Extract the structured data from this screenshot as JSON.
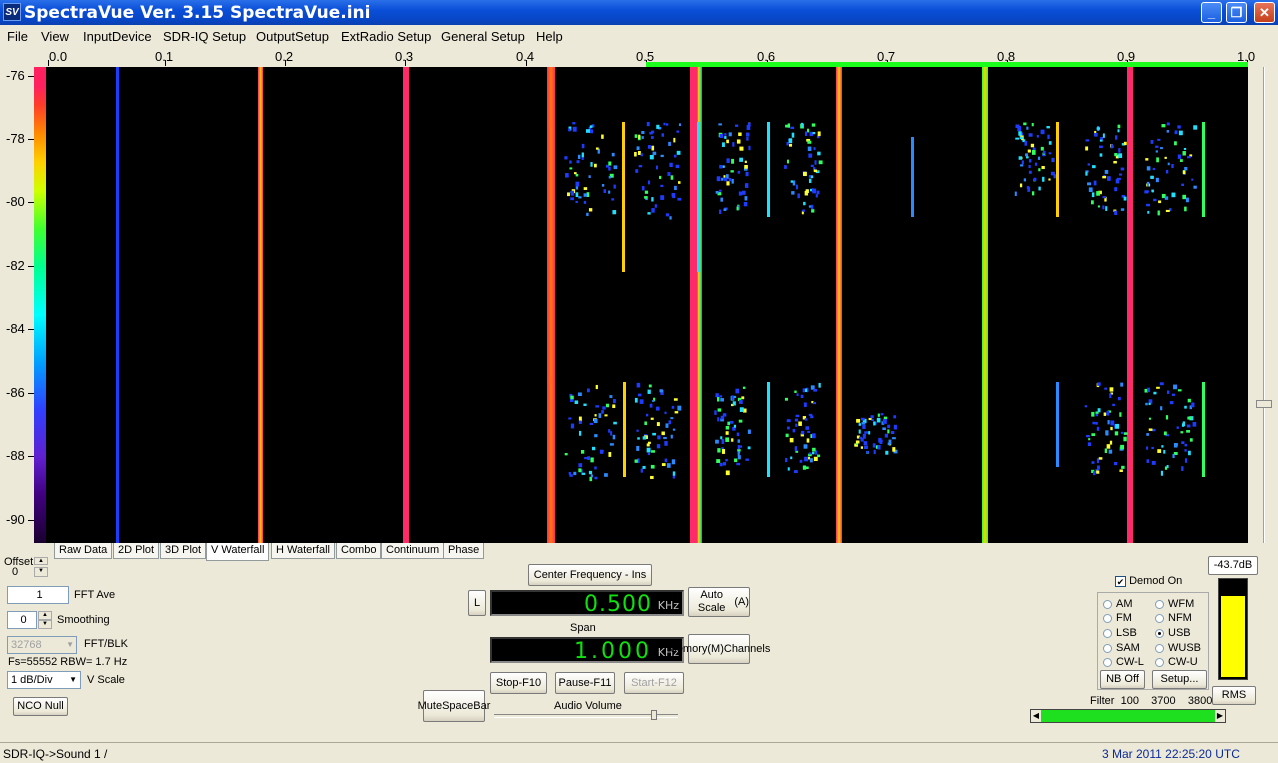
{
  "window": {
    "title": "SpectraVue Ver. 3.15  SpectraVue.ini",
    "icon": "SV"
  },
  "menu": [
    "File",
    "View",
    "InputDevice",
    "SDR-IQ Setup",
    "OutputSetup",
    "ExtRadio Setup",
    "General Setup",
    "Help"
  ],
  "plot": {
    "x_ticks": [
      "0.0",
      "0.1",
      "0.2",
      "0.3",
      "0.4",
      "0.5",
      "0.6",
      "0.7",
      "0.8",
      "0.9",
      "1.0"
    ],
    "y_ticks": [
      "-76",
      "-78",
      "-80",
      "-82",
      "-84",
      "-86",
      "-88",
      "-90"
    ]
  },
  "tabs": [
    "Raw Data",
    "2D Plot",
    "3D Plot",
    "V Waterfall",
    "H Waterfall",
    "Combo",
    "Continuum",
    "Phase"
  ],
  "active_tab": "V Waterfall",
  "left_panel": {
    "offset_label": "Offset",
    "offset_value": "0",
    "fft_ave_value": "1",
    "fft_ave_label": "FFT Ave",
    "smoothing_value": "0",
    "smoothing_label": "Smoothing",
    "fft_blk_value": "32768",
    "fft_blk_label": "FFT/BLK",
    "fs_info": "Fs=55552 RBW= 1.7 Hz",
    "vscale_value": "1 dB/Div",
    "vscale_label": "V Scale",
    "nco_null": "NCO Null"
  },
  "center": {
    "center_freq_button": "Center Frequency - Ins",
    "l_button": "L",
    "center_value": "0.500",
    "center_unit": "KHz",
    "span_label": "Span",
    "span_value": "1.000",
    "span_unit": "KHz",
    "auto_scale": [
      "Auto Scale",
      "(A)"
    ],
    "memory": [
      "Memory(M)",
      "Channels"
    ],
    "stop": "Stop-F10",
    "pause": "Pause-F11",
    "start": "Start-F12",
    "mute": [
      "Mute",
      "SpaceBar"
    ],
    "audio_volume_label": "Audio Volume",
    "audio_volume_level": 0.88
  },
  "demod": {
    "level_label": "-43.7dB",
    "demod_on_label": "Demod On",
    "demod_on_checked": true,
    "modes": [
      "AM",
      "WFM",
      "FM",
      "NFM",
      "LSB",
      "USB",
      "SAM",
      "WUSB",
      "CW-L",
      "CW-U"
    ],
    "selected": "USB",
    "nb_off": "NB Off",
    "setup": "Setup...",
    "rms": "RMS",
    "meter_level": 0.83,
    "filter_label": "Filter",
    "filter_values": [
      "100",
      "3700",
      "3800"
    ]
  },
  "status": {
    "left": "SDR-IQ->Sound 1  /",
    "right": "3 Mar 2011   22:25:20 UTC"
  },
  "colors": {
    "title_blue": "#0a4fd8",
    "lcd_green": "#10e010",
    "marker_green": "#1cff1c",
    "stripe_pink": "#ff2a6a"
  }
}
